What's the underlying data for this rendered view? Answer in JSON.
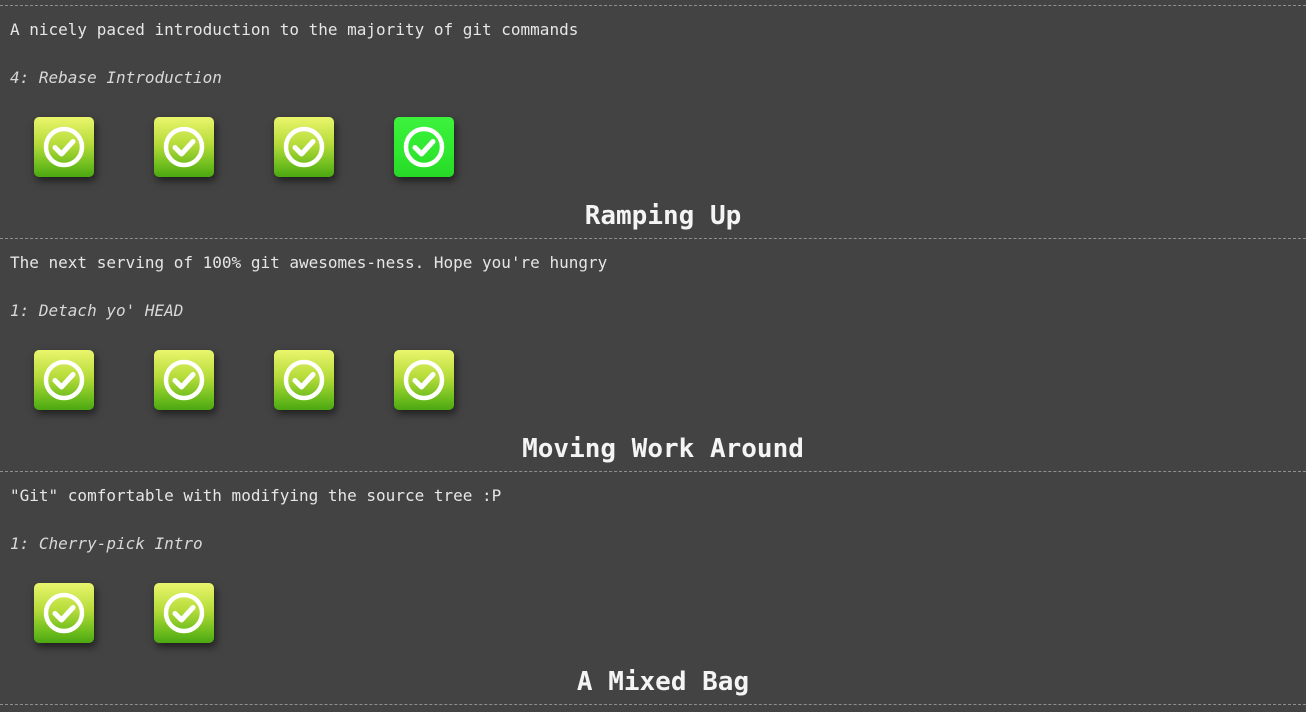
{
  "sections": [
    {
      "description": "A nicely paced introduction to the majority of git commands",
      "current_level": "4: Rebase Introduction",
      "levels": [
        {
          "label": "level 1",
          "solved": true,
          "current": false
        },
        {
          "label": "level 2",
          "solved": true,
          "current": false
        },
        {
          "label": "level 3",
          "solved": true,
          "current": false
        },
        {
          "label": "level 4",
          "solved": true,
          "current": true
        }
      ],
      "next_title": "Ramping Up"
    },
    {
      "description": "The next serving of 100% git awesomes-ness. Hope you're hungry",
      "current_level": "1: Detach yo' HEAD",
      "levels": [
        {
          "label": "level 1",
          "solved": true,
          "current": false
        },
        {
          "label": "level 2",
          "solved": true,
          "current": false
        },
        {
          "label": "level 3",
          "solved": true,
          "current": false
        },
        {
          "label": "level 4",
          "solved": true,
          "current": false
        }
      ],
      "next_title": "Moving Work Around"
    },
    {
      "description": "\"Git\" comfortable with modifying the source tree :P",
      "current_level": "1: Cherry-pick Intro",
      "levels": [
        {
          "label": "level 1",
          "solved": true,
          "current": false
        },
        {
          "label": "level 2",
          "solved": true,
          "current": false
        }
      ],
      "next_title": "A Mixed Bag"
    }
  ],
  "icons": {
    "level_icon": "check-circle-icon"
  },
  "colors": {
    "background": "#434343",
    "solved_gradient_top": "#eaf56c",
    "solved_gradient_bottom": "#4ca712",
    "current_level": "#33ee33"
  }
}
